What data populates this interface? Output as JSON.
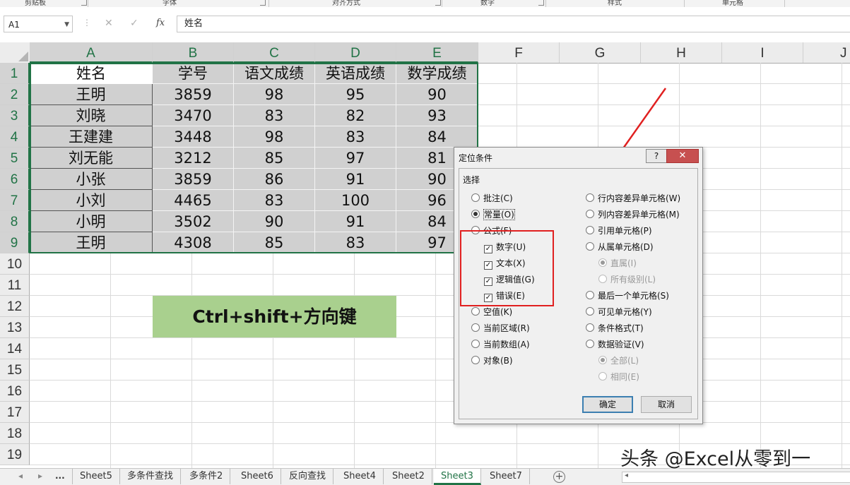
{
  "ribbon": {
    "groups": [
      "剪贴板",
      "字体",
      "对齐方式",
      "数字",
      "样式",
      "单元格"
    ]
  },
  "formula_bar": {
    "name_box": "A1",
    "cancel_icon": "✕",
    "enter_icon": "✓",
    "fx_label": "fx",
    "content": "姓名"
  },
  "columns": [
    "A",
    "B",
    "C",
    "D",
    "E",
    "F",
    "G",
    "H",
    "I",
    "J"
  ],
  "rows": [
    "1",
    "2",
    "3",
    "4",
    "5",
    "6",
    "7",
    "8",
    "9",
    "10",
    "11",
    "12",
    "13",
    "14",
    "15",
    "16",
    "17",
    "18",
    "19"
  ],
  "table": {
    "headers": [
      "姓名",
      "学号",
      "语文成绩",
      "英语成绩",
      "数学成绩"
    ],
    "rows": [
      [
        "王明",
        "3859",
        "98",
        "95",
        "90"
      ],
      [
        "刘晓",
        "3470",
        "83",
        "82",
        "93"
      ],
      [
        "王建建",
        "3448",
        "98",
        "83",
        "84"
      ],
      [
        "刘无能",
        "3212",
        "85",
        "97",
        "81"
      ],
      [
        "小张",
        "3859",
        "86",
        "91",
        "90"
      ],
      [
        "小刘",
        "4465",
        "83",
        "100",
        "96"
      ],
      [
        "小明",
        "3502",
        "90",
        "91",
        "84"
      ],
      [
        "王明",
        "4308",
        "85",
        "83",
        "97"
      ]
    ]
  },
  "shortcut_label": "Ctrl+shift+方向键",
  "dialog": {
    "title": "定位条件",
    "help": "?",
    "close": "✕",
    "group_label": "选择",
    "left_options": [
      {
        "label": "批注(C)",
        "kind": "radio",
        "checked": false
      },
      {
        "label": "常量(O)",
        "kind": "radio",
        "checked": true
      },
      {
        "label": "公式(F)",
        "kind": "radio",
        "checked": false
      },
      {
        "label": "数字(U)",
        "kind": "check",
        "checked": true
      },
      {
        "label": "文本(X)",
        "kind": "check",
        "checked": true
      },
      {
        "label": "逻辑值(G)",
        "kind": "check",
        "checked": true
      },
      {
        "label": "错误(E)",
        "kind": "check",
        "checked": true
      },
      {
        "label": "空值(K)",
        "kind": "radio",
        "checked": false
      },
      {
        "label": "当前区域(R)",
        "kind": "radio",
        "checked": false
      },
      {
        "label": "当前数组(A)",
        "kind": "radio",
        "checked": false
      },
      {
        "label": "对象(B)",
        "kind": "radio",
        "checked": false
      }
    ],
    "right_options": [
      {
        "label": "行内容差异单元格(W)",
        "kind": "radio",
        "checked": false
      },
      {
        "label": "列内容差异单元格(M)",
        "kind": "radio",
        "checked": false
      },
      {
        "label": "引用单元格(P)",
        "kind": "radio",
        "checked": false
      },
      {
        "label": "从属单元格(D)",
        "kind": "radio",
        "checked": false
      },
      {
        "label": "直属(I)",
        "kind": "radio",
        "checked": true,
        "disabled": true
      },
      {
        "label": "所有级别(L)",
        "kind": "radio",
        "checked": false,
        "disabled": true
      },
      {
        "label": "最后一个单元格(S)",
        "kind": "radio",
        "checked": false
      },
      {
        "label": "可见单元格(Y)",
        "kind": "radio",
        "checked": false
      },
      {
        "label": "条件格式(T)",
        "kind": "radio",
        "checked": false
      },
      {
        "label": "数据验证(V)",
        "kind": "radio",
        "checked": false
      },
      {
        "label": "全部(L)",
        "kind": "radio",
        "checked": true,
        "disabled": true
      },
      {
        "label": "相同(E)",
        "kind": "radio",
        "checked": false,
        "disabled": true
      }
    ],
    "ok": "确定",
    "cancel": "取消"
  },
  "sheet_tabs": {
    "nav_prev": "◂",
    "nav_next": "▸",
    "ellipsis": "...",
    "tabs": [
      "Sheet5",
      "多条件查找",
      "多条件2",
      "Sheet6",
      "反向查找",
      "Sheet4",
      "Sheet2",
      "Sheet3",
      "Sheet7"
    ],
    "active": "Sheet3",
    "add": "+"
  },
  "watermark": "头条 @Excel从零到一",
  "colors": {
    "excel_green": "#217346",
    "selected_fill": "#d0d0d0",
    "shortcut_fill": "#a9d08e",
    "annotation_red": "#e02020"
  }
}
